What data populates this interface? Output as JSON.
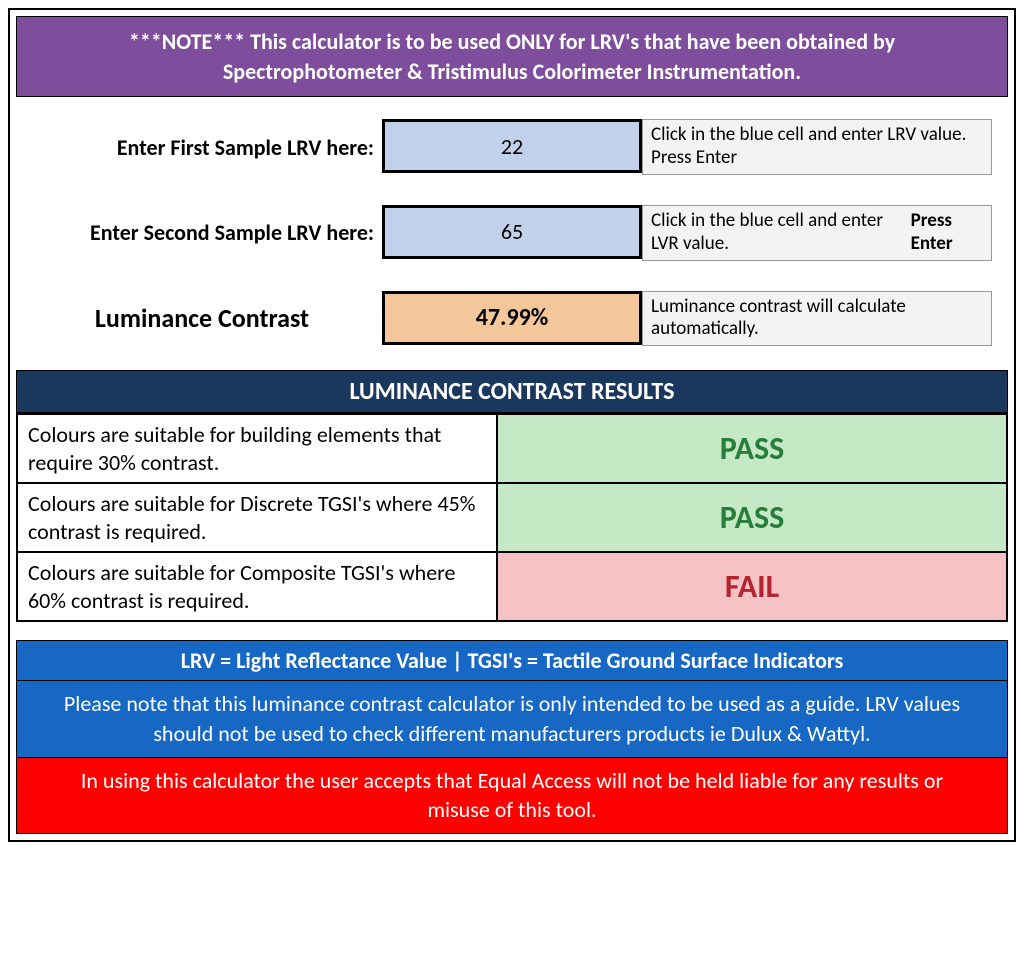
{
  "note": "***NOTE*** This calculator is to be used ONLY for LRV's that have been obtained by Spectrophotometer & Tristimulus Colorimeter Instrumentation.",
  "inputs": {
    "first": {
      "label": "Enter First Sample LRV here:",
      "value": "22",
      "hint_pre": "Click in the blue cell and enter LRV value. Press Enter",
      "hint_strong": ""
    },
    "second": {
      "label": "Enter Second Sample LRV here:",
      "value": "65",
      "hint_pre": "Click in the blue cell and enter LVR value. ",
      "hint_strong": "Press Enter"
    },
    "contrast": {
      "label": "Luminance Contrast",
      "value": "47.99%",
      "hint": "Luminance contrast will calculate automatically."
    }
  },
  "results_header": "LUMINANCE CONTRAST RESULTS",
  "results": [
    {
      "desc": "Colours are suitable for building elements that require 30% contrast.",
      "status": "PASS"
    },
    {
      "desc": "Colours are suitable for Discrete TGSI's where 45% contrast is required.",
      "status": "PASS"
    },
    {
      "desc": "Colours are suitable for Composite TGSI's where 60% contrast is required.",
      "status": "FAIL"
    }
  ],
  "defs": "LRV = Light Reflectance Value | TGSI's = Tactile Ground Surface Indicators",
  "guide": "Please note that this luminance contrast calculator is only intended to be used as a guide. LRV values should not be used to check different manufacturers products ie Dulux & Wattyl.",
  "disclaimer": "In using this calculator the user accepts that Equal Access will not be held liable for any results or misuse of this tool."
}
